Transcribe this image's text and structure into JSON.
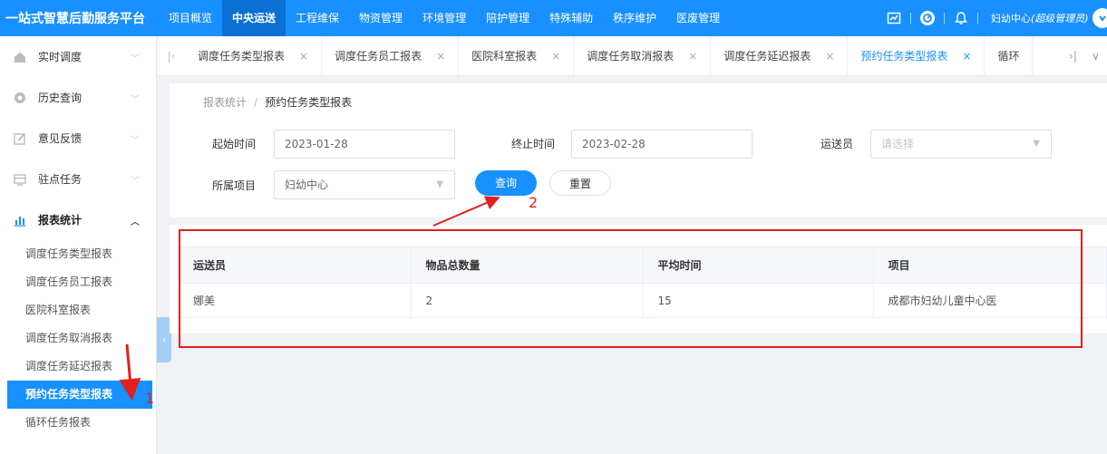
{
  "header": {
    "brand": "一站式智慧后勤服务平台",
    "nav": [
      "项目概览",
      "中央运送",
      "工程维保",
      "物资管理",
      "环境管理",
      "陪护管理",
      "特殊辅助",
      "秩序维护",
      "医废管理"
    ],
    "active_nav": "中央运送",
    "user": {
      "name": "妇幼中心",
      "role": "(超级管理员)"
    }
  },
  "sidebar": {
    "items": [
      {
        "label": "实时调度",
        "icon": "home-icon"
      },
      {
        "label": "历史查询",
        "icon": "clock-icon"
      },
      {
        "label": "意见反馈",
        "icon": "edit-icon"
      },
      {
        "label": "驻点任务",
        "icon": "monitor-icon"
      },
      {
        "label": "报表统计",
        "icon": "bar-chart-icon"
      }
    ],
    "submenu": [
      "调度任务类型报表",
      "调度任务员工报表",
      "医院科室报表",
      "调度任务取消报表",
      "调度任务延迟报表",
      "预约任务类型报表",
      "循环任务报表"
    ],
    "active_sub": "预约任务类型报表"
  },
  "tabs": [
    "调度任务类型报表",
    "调度任务员工报表",
    "医院科室报表",
    "调度任务取消报表",
    "调度任务延迟报表",
    "预约任务类型报表",
    "循环"
  ],
  "active_tab": "预约任务类型报表",
  "breadcrumb": {
    "parent": "报表统计",
    "current": "预约任务类型报表"
  },
  "filters": {
    "start_label": "起始时间",
    "start_value": "2023-01-28",
    "end_label": "终止时间",
    "end_value": "2023-02-28",
    "courier_label": "运送员",
    "courier_placeholder": "请选择",
    "project_label": "所属项目",
    "project_value": "妇幼中心",
    "query_label": "查询",
    "reset_label": "重置"
  },
  "table": {
    "columns": [
      "运送员",
      "物品总数量",
      "平均时间",
      "项目"
    ],
    "rows": [
      [
        "娜美",
        "2",
        "15",
        "成都市妇幼儿童中心医"
      ]
    ]
  },
  "annotations": {
    "step1": "1",
    "step2": "2",
    "color": "#e02020"
  },
  "colors": {
    "primary": "#1890ff"
  }
}
